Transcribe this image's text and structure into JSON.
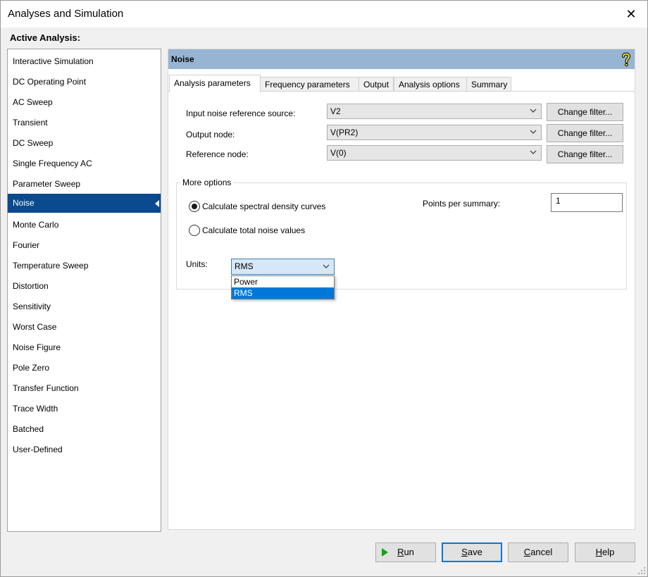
{
  "window": {
    "title": "Analyses and Simulation",
    "close_glyph": "✕"
  },
  "sidebar": {
    "label": "Active Analysis:",
    "selected_index": 7,
    "items": [
      {
        "label": "Interactive Simulation"
      },
      {
        "label": "DC Operating Point"
      },
      {
        "label": "AC Sweep"
      },
      {
        "label": "Transient"
      },
      {
        "label": "DC Sweep"
      },
      {
        "label": "Single Frequency AC"
      },
      {
        "label": "Parameter Sweep"
      },
      {
        "label": "Noise"
      },
      {
        "label": "Monte Carlo"
      },
      {
        "label": "Fourier"
      },
      {
        "label": "Temperature Sweep"
      },
      {
        "label": "Distortion"
      },
      {
        "label": "Sensitivity"
      },
      {
        "label": "Worst Case"
      },
      {
        "label": "Noise Figure"
      },
      {
        "label": "Pole Zero"
      },
      {
        "label": "Transfer Function"
      },
      {
        "label": "Trace Width"
      },
      {
        "label": "Batched"
      },
      {
        "label": "User-Defined"
      }
    ]
  },
  "panel": {
    "title": "Noise",
    "help_icon": "question-mark-icon",
    "header_color": "#97b4d3",
    "tabs": [
      {
        "label": "Analysis parameters",
        "active": true
      },
      {
        "label": "Frequency parameters",
        "active": false
      },
      {
        "label": "Output",
        "active": false
      },
      {
        "label": "Analysis options",
        "active": false
      },
      {
        "label": "Summary",
        "active": false
      }
    ],
    "fields": [
      {
        "label": "Input noise reference source:",
        "value": "V2",
        "button": "Change filter..."
      },
      {
        "label": "Output node:",
        "value": "V(PR2)",
        "button": "Change filter..."
      },
      {
        "label": "Reference node:",
        "value": "V(0)",
        "button": "Change filter..."
      }
    ],
    "more_options": {
      "title": "More options",
      "radio_spectral": "Calculate spectral density curves",
      "radio_total": "Calculate total noise values",
      "selected_radio": "spectral",
      "points_label": "Points per summary:",
      "points_value": "1",
      "units_label": "Units:",
      "units_value": "RMS",
      "units_options": [
        "Power",
        "RMS"
      ],
      "units_highlighted": "RMS"
    }
  },
  "footer": {
    "run": {
      "accel": "R",
      "rest": "un"
    },
    "save": {
      "accel": "S",
      "rest": "ave"
    },
    "cancel": {
      "accel": "C",
      "rest": "ancel"
    },
    "help": {
      "accel": "H",
      "rest": "elp"
    }
  },
  "colors": {
    "selection": "#0a4a8e",
    "accent": "#0078d7",
    "run_icon": "#16a316"
  }
}
